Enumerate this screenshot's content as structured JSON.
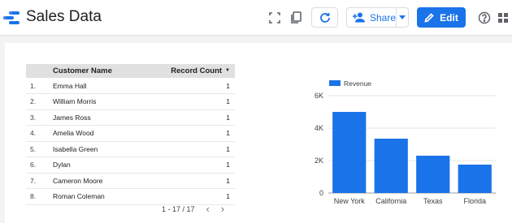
{
  "header": {
    "title": "Sales Data",
    "share_label": "Share",
    "edit_label": "Edit"
  },
  "table": {
    "columns": [
      "Customer Name",
      "Record Count"
    ],
    "rows": [
      {
        "index": "1.",
        "name": "Emma Hall",
        "count": "1"
      },
      {
        "index": "2.",
        "name": "William Morris",
        "count": "1"
      },
      {
        "index": "3.",
        "name": "James Ross",
        "count": "1"
      },
      {
        "index": "4.",
        "name": "Amelia Wood",
        "count": "1"
      },
      {
        "index": "5.",
        "name": "Isabella Green",
        "count": "1"
      },
      {
        "index": "6.",
        "name": "Dylan",
        "count": "1"
      },
      {
        "index": "7.",
        "name": "Cameron Moore",
        "count": "1"
      },
      {
        "index": "8.",
        "name": "Roman Coleman",
        "count": "1"
      }
    ],
    "pagination": "1 - 17 / 17"
  },
  "chart_data": {
    "type": "bar",
    "categories": [
      "New York",
      "California",
      "Texas",
      "Florida"
    ],
    "series": [
      {
        "name": "Revenue",
        "values": [
          5000,
          3350,
          2300,
          1750
        ]
      }
    ],
    "ylim": [
      0,
      6000
    ],
    "yticks": [
      "0",
      "2K",
      "4K",
      "6K"
    ],
    "grid": true,
    "legend": "top-left",
    "color": "#1a73e8"
  }
}
